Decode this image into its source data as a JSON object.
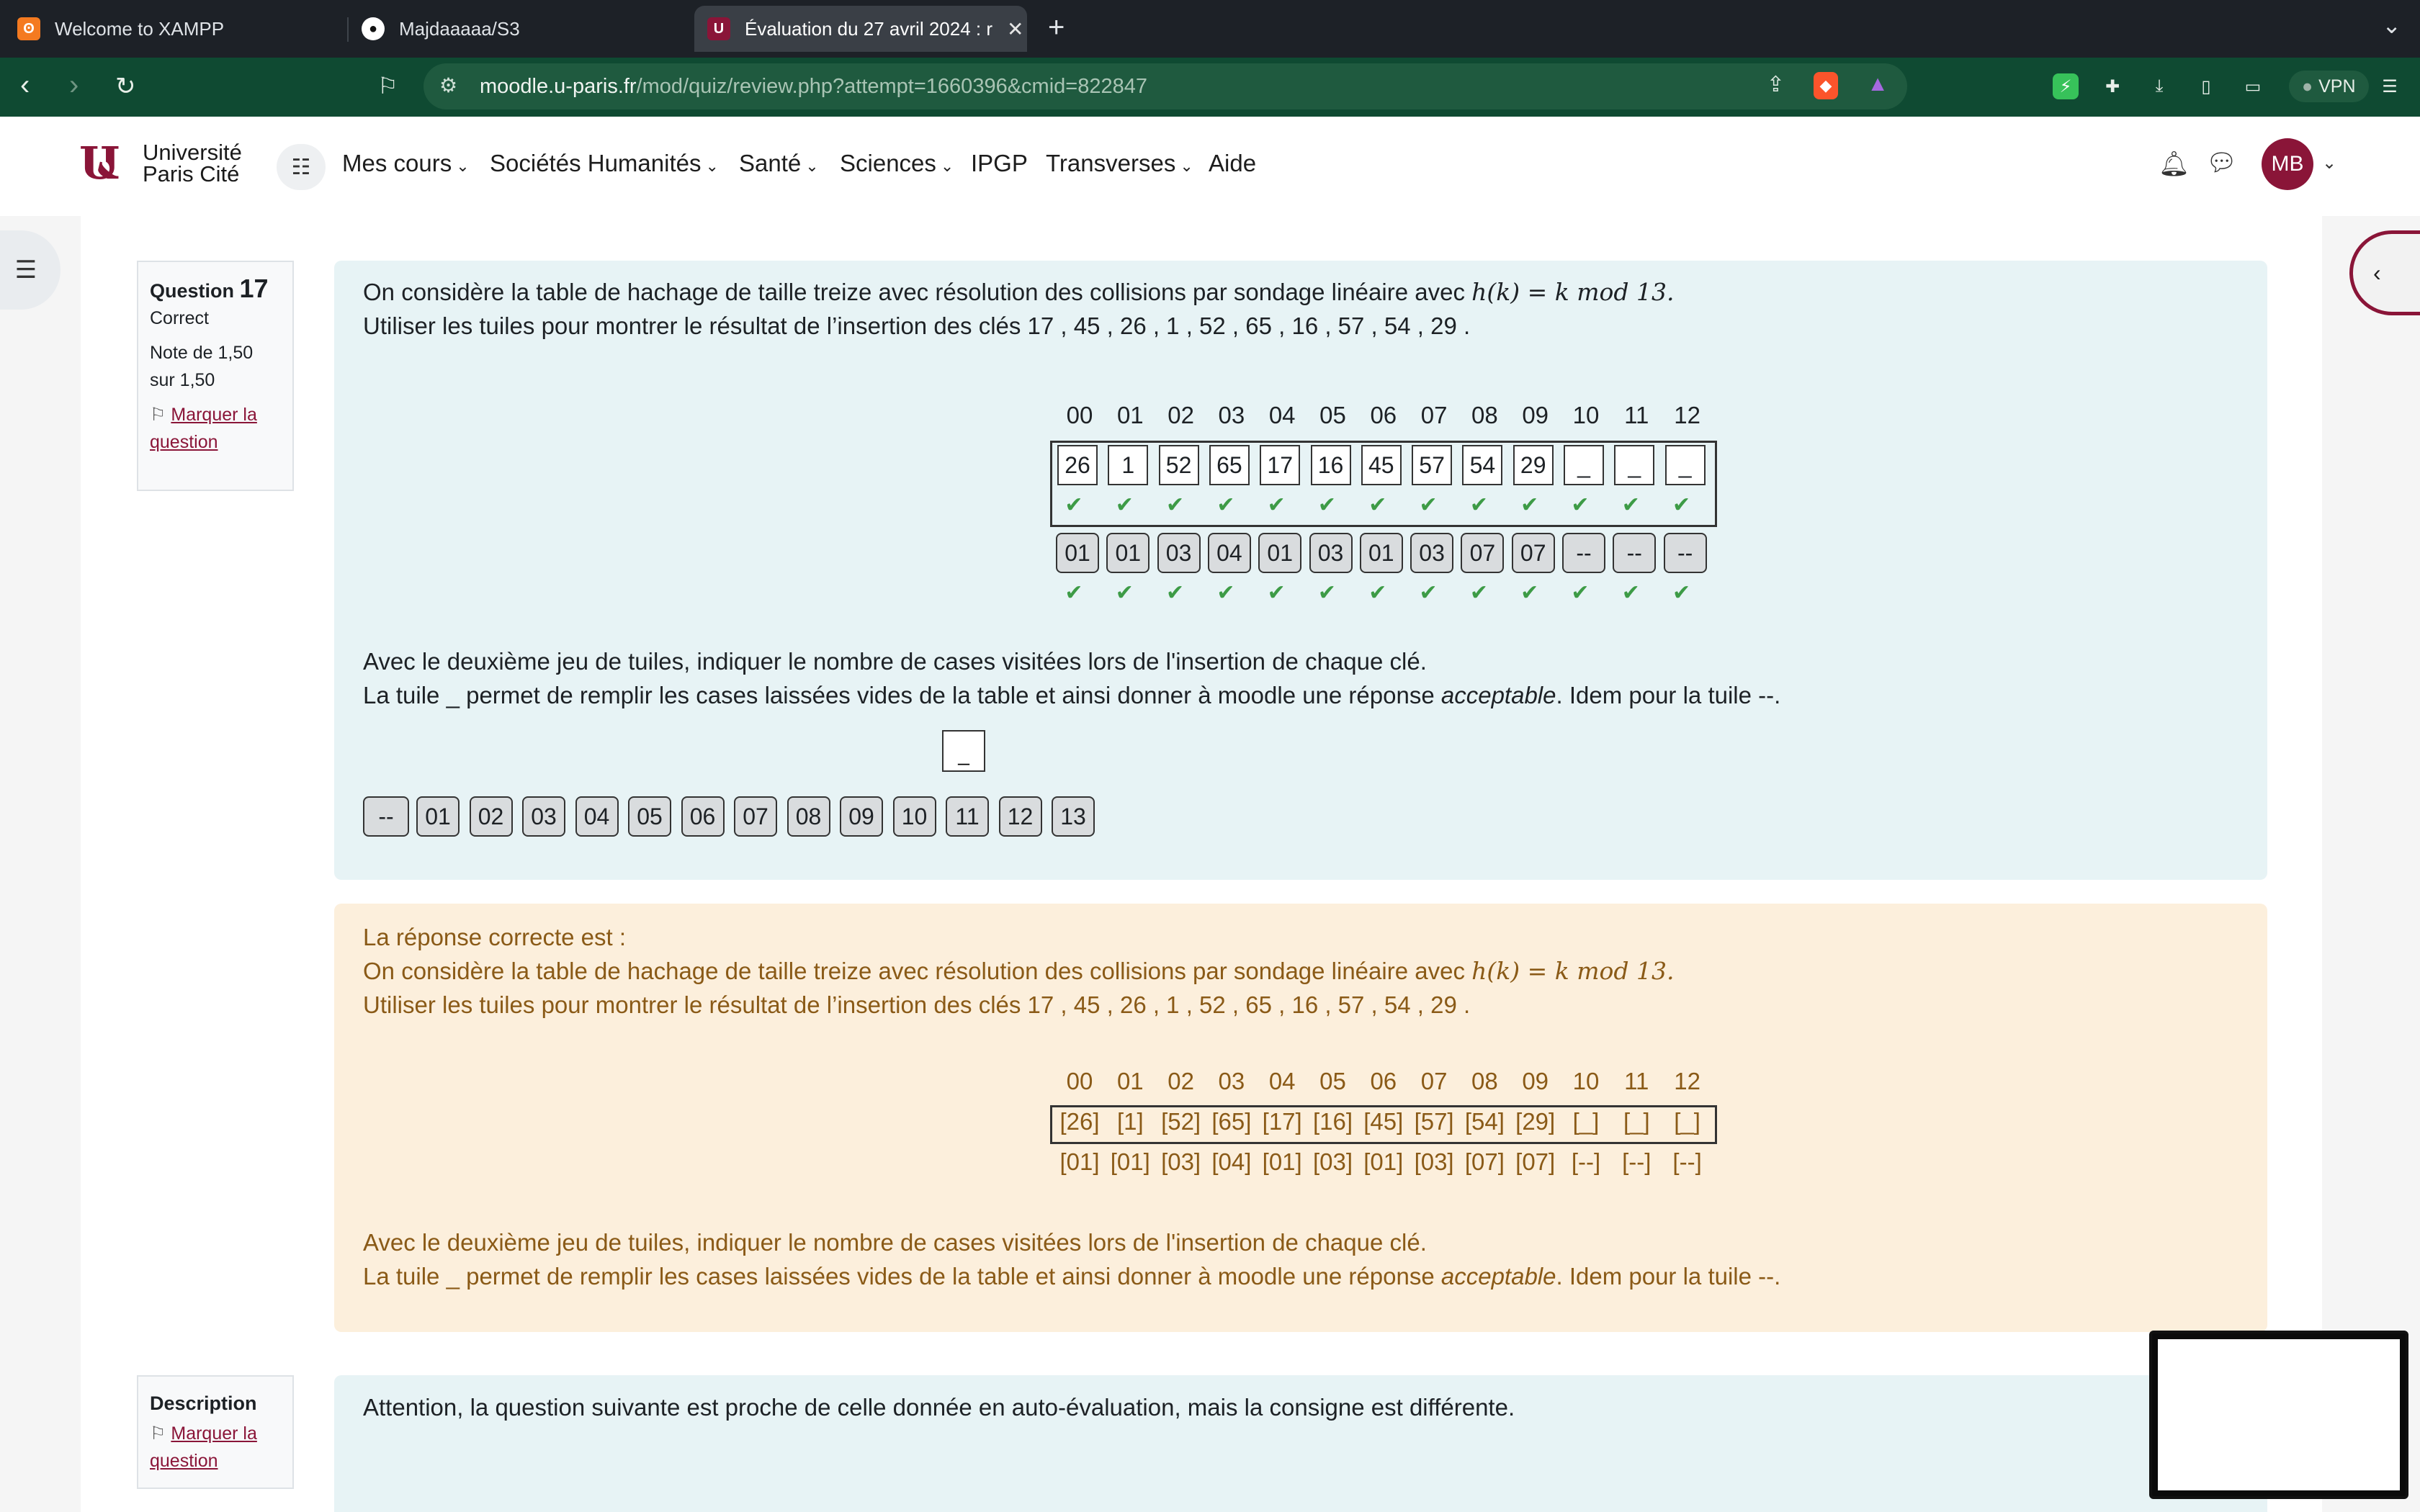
{
  "browser": {
    "tabs": [
      {
        "title": "Welcome to XAMPP",
        "icon": "xampp-icon"
      },
      {
        "title": "Majdaaaaa/S3",
        "icon": "github-icon"
      },
      {
        "title": "Évaluation du 27 avril 2024 : r",
        "icon": "moodle-icon",
        "active": true
      }
    ],
    "url_host": "moodle.u-paris.fr",
    "url_path": "/mod/quiz/review.php?attempt=1660396&cmid=822847",
    "vpn_label": "VPN"
  },
  "site": {
    "logo_line1": "Université",
    "logo_line2": "Paris Cité",
    "menu": [
      "Mes cours",
      "Sociétés Humanités",
      "Santé",
      "Sciences",
      "IPGP",
      "Transverses",
      "Aide"
    ],
    "menu_has_chevron": [
      true,
      true,
      true,
      true,
      false,
      true,
      false
    ],
    "avatar_initials": "MB",
    "accent": "#8a1538"
  },
  "question": {
    "label": "Question",
    "number": "17",
    "status": "Correct",
    "grade": "Note de 1,50 sur 1,50",
    "flag_label": "Marquer la question",
    "intro_prefix": "On considère la table de hachage de taille treize avec résolution des collisions par sondage linéaire avec",
    "hash_function": "h(k) = k  mod  13.",
    "keys_line": "Utiliser les tuiles pour montrer le résultat de l’insertion des clés  17 , 45 , 26 , 1 , 52 , 65 , 16 , 57 , 54 , 29 .",
    "indices": [
      "00",
      "01",
      "02",
      "03",
      "04",
      "05",
      "06",
      "07",
      "08",
      "09",
      "10",
      "11",
      "12"
    ],
    "table_values": [
      "26",
      "1",
      "52",
      "65",
      "17",
      "16",
      "45",
      "57",
      "54",
      "29",
      "_",
      "_",
      "_"
    ],
    "visit_values": [
      "01",
      "01",
      "03",
      "04",
      "01",
      "03",
      "01",
      "03",
      "07",
      "07",
      "--",
      "--",
      "--"
    ],
    "check_mark": "✔",
    "instruction1": "Avec le deuxième jeu de tuiles, indiquer le nombre de cases visitées lors de l'insertion de chaque clé.",
    "instruction2_a": "La tuile _ permet de remplir les cases laissées vides de la table et ainsi donner à moodle une réponse",
    "instruction2_em": "acceptable",
    "instruction2_b": ". Idem pour la tuile --.",
    "spare_tile": "_",
    "tile_palette": [
      "--",
      "01",
      "02",
      "03",
      "04",
      "05",
      "06",
      "07",
      "08",
      "09",
      "10",
      "11",
      "12",
      "13"
    ]
  },
  "feedback": {
    "heading": "La réponse correcte est :",
    "table_values": [
      "[26]",
      "[1]",
      "[52]",
      "[65]",
      "[17]",
      "[16]",
      "[45]",
      "[57]",
      "[54]",
      "[29]",
      "[_]",
      "[_]",
      "[_]"
    ],
    "visit_values": [
      "[01]",
      "[01]",
      "[03]",
      "[04]",
      "[01]",
      "[03]",
      "[01]",
      "[03]",
      "[07]",
      "[07]",
      "[--]",
      "[--]",
      "[--]"
    ]
  },
  "description": {
    "label": "Description",
    "flag_label": "Marquer la question",
    "text": "Attention, la question suivante est proche de celle donnée en auto-évaluation, mais la consigne est différente."
  }
}
